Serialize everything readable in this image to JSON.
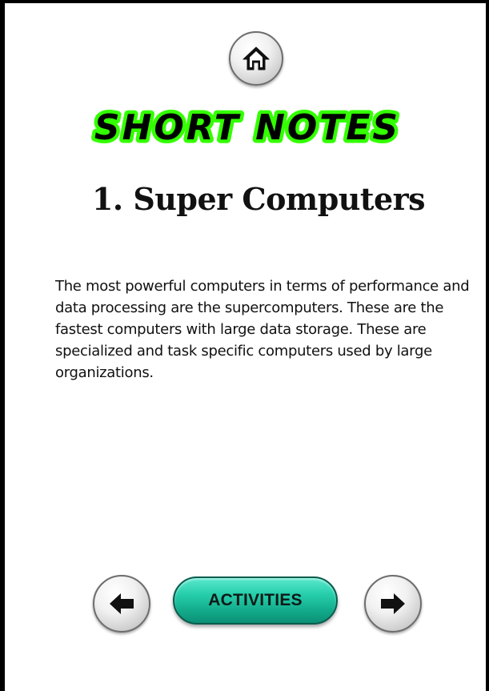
{
  "header": {
    "home_icon": "home-icon",
    "banner_text": "SHORT NOTES"
  },
  "content": {
    "heading": "1. Super Computers",
    "paragraph": "The most powerful computers in terms of performance and data processing are the supercomputers. These are the fastest computers with large data storage. These are specialized and task specific computers used by large organizations."
  },
  "footer": {
    "prev_icon": "arrow-left-icon",
    "activities_label": "ACTIVITIES",
    "next_icon": "arrow-right-icon"
  },
  "colors": {
    "banner_fill": "#000000",
    "banner_glow": "#33ff00",
    "activities_button": "#1bbf9c",
    "frame": "#000000"
  }
}
